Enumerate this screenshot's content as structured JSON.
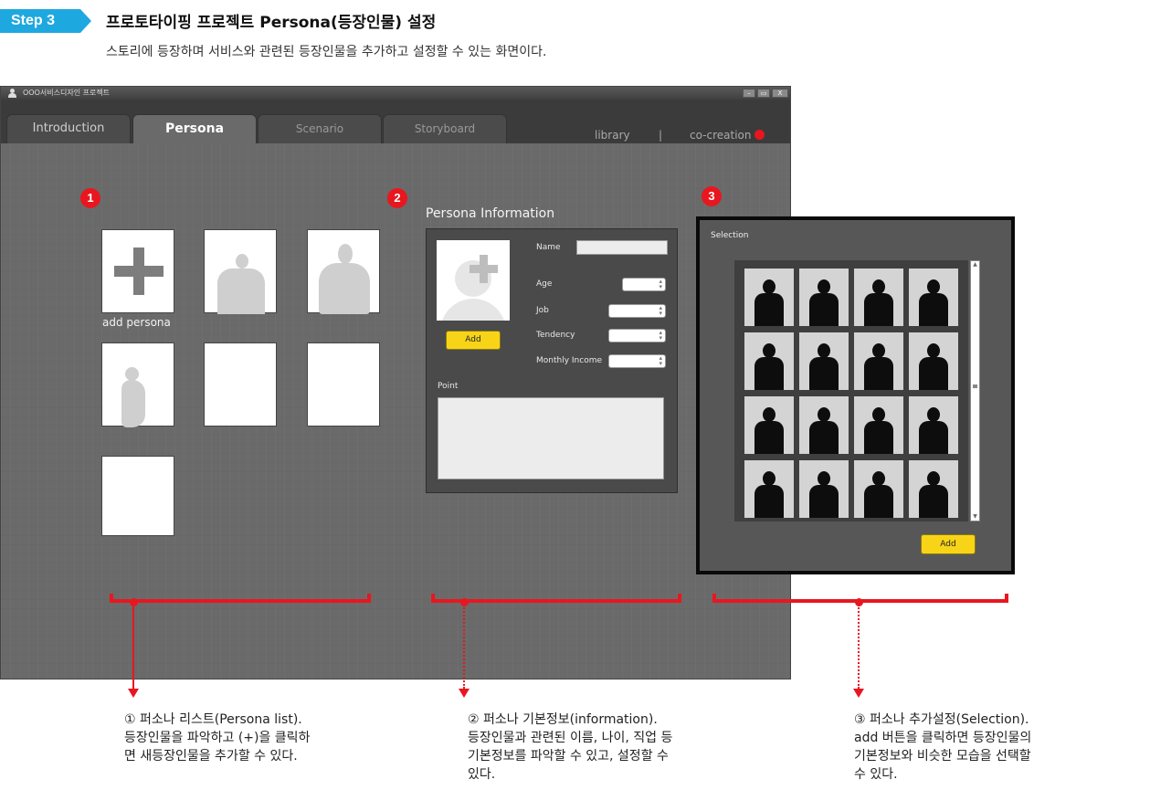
{
  "header": {
    "step": "Step 3",
    "title": "프로토타이핑 프로젝트 Persona(등장인물) 설정",
    "subtitle": "스토리에 등장하며 서비스와 관련된 등장인물을 추가하고 설정할 수 있는 화면이다."
  },
  "app": {
    "window_title": "OOO서비스디자인 프로젝트",
    "window_buttons": [
      "minimize",
      "maximize",
      "close"
    ],
    "window_button_labels": {
      "minimize": "–",
      "maximize": "▭",
      "close": "X"
    },
    "tabs": [
      {
        "label": "Introduction",
        "state": "inactive"
      },
      {
        "label": "Persona",
        "state": "active"
      },
      {
        "label": "Scenario",
        "state": "dim"
      },
      {
        "label": "Storyboard",
        "state": "dim"
      }
    ],
    "links": {
      "library": "library",
      "separator": "|",
      "cocreation": "co-creation"
    },
    "accent": "#e8171f"
  },
  "markers": [
    "1",
    "2",
    "3"
  ],
  "persona_list": {
    "add_label": "add persona",
    "cards": [
      {
        "type": "add"
      },
      {
        "type": "silhouette",
        "figure": "man-hands-on-hips"
      },
      {
        "type": "silhouette",
        "figure": "woman-hands-on-hips"
      },
      {
        "type": "silhouette",
        "figure": "pregnant-woman"
      },
      {
        "type": "empty"
      },
      {
        "type": "empty"
      },
      {
        "type": "empty"
      }
    ]
  },
  "persona_info": {
    "title": "Persona Information",
    "add_button": "Add",
    "fields": {
      "name": {
        "label": "Name",
        "value": ""
      },
      "age": {
        "label": "Age",
        "value": ""
      },
      "job": {
        "label": "Job",
        "value": ""
      },
      "tendency": {
        "label": "Tendency",
        "value": ""
      },
      "monthly_income": {
        "label": "Monthly Income",
        "value": ""
      }
    },
    "point_label": "Point",
    "point_value": ""
  },
  "selection": {
    "title": "Selection",
    "add_button": "Add",
    "thumbnails_count": 16,
    "scroll_up": "▲",
    "scroll_down": "▼"
  },
  "descriptions": [
    {
      "lines": [
        "① 퍼소나 리스트(Persona list).",
        "등장인물을 파악하고 (+)을 클릭하",
        "면 새등장인물을 추가할 수 있다."
      ]
    },
    {
      "lines": [
        "② 퍼소나 기본정보(information).",
        "등장인물과 관련된 이름, 나이, 직업 등",
        "기본정보를 파악할 수 있고, 설정할 수",
        "있다."
      ]
    },
    {
      "lines": [
        "③ 퍼소나 추가설정(Selection).",
        " add 버튼을 클릭하면 등장인물의",
        "기본정보와 비슷한 모습을 선택할",
        "수 있다."
      ]
    }
  ]
}
